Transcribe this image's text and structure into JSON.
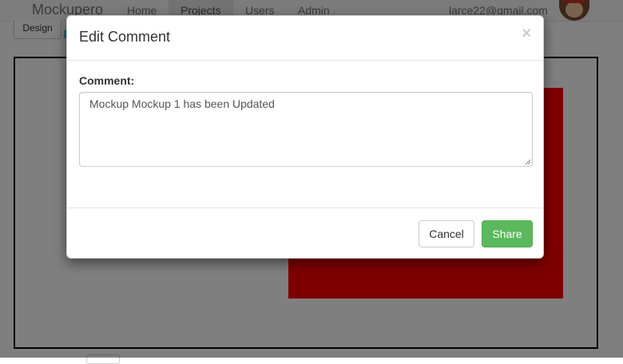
{
  "navbar": {
    "brand": "Mockupero",
    "items": [
      "Home",
      "Projects",
      "Users",
      "Admin"
    ],
    "active": "Projects",
    "user_email": "larce22@gmail.com"
  },
  "background": {
    "design_button": "Design",
    "shape_color": "#ff0000"
  },
  "modal": {
    "title": "Edit Comment",
    "close_label": "×",
    "comment_label": "Comment:",
    "comment_value": "Mockup Mockup 1 has been Updated",
    "cancel_label": "Cancel",
    "share_label": "Share"
  },
  "colors": {
    "accent_success": "#5cb85c",
    "backdrop": "rgba(0,0,0,0.5)"
  }
}
